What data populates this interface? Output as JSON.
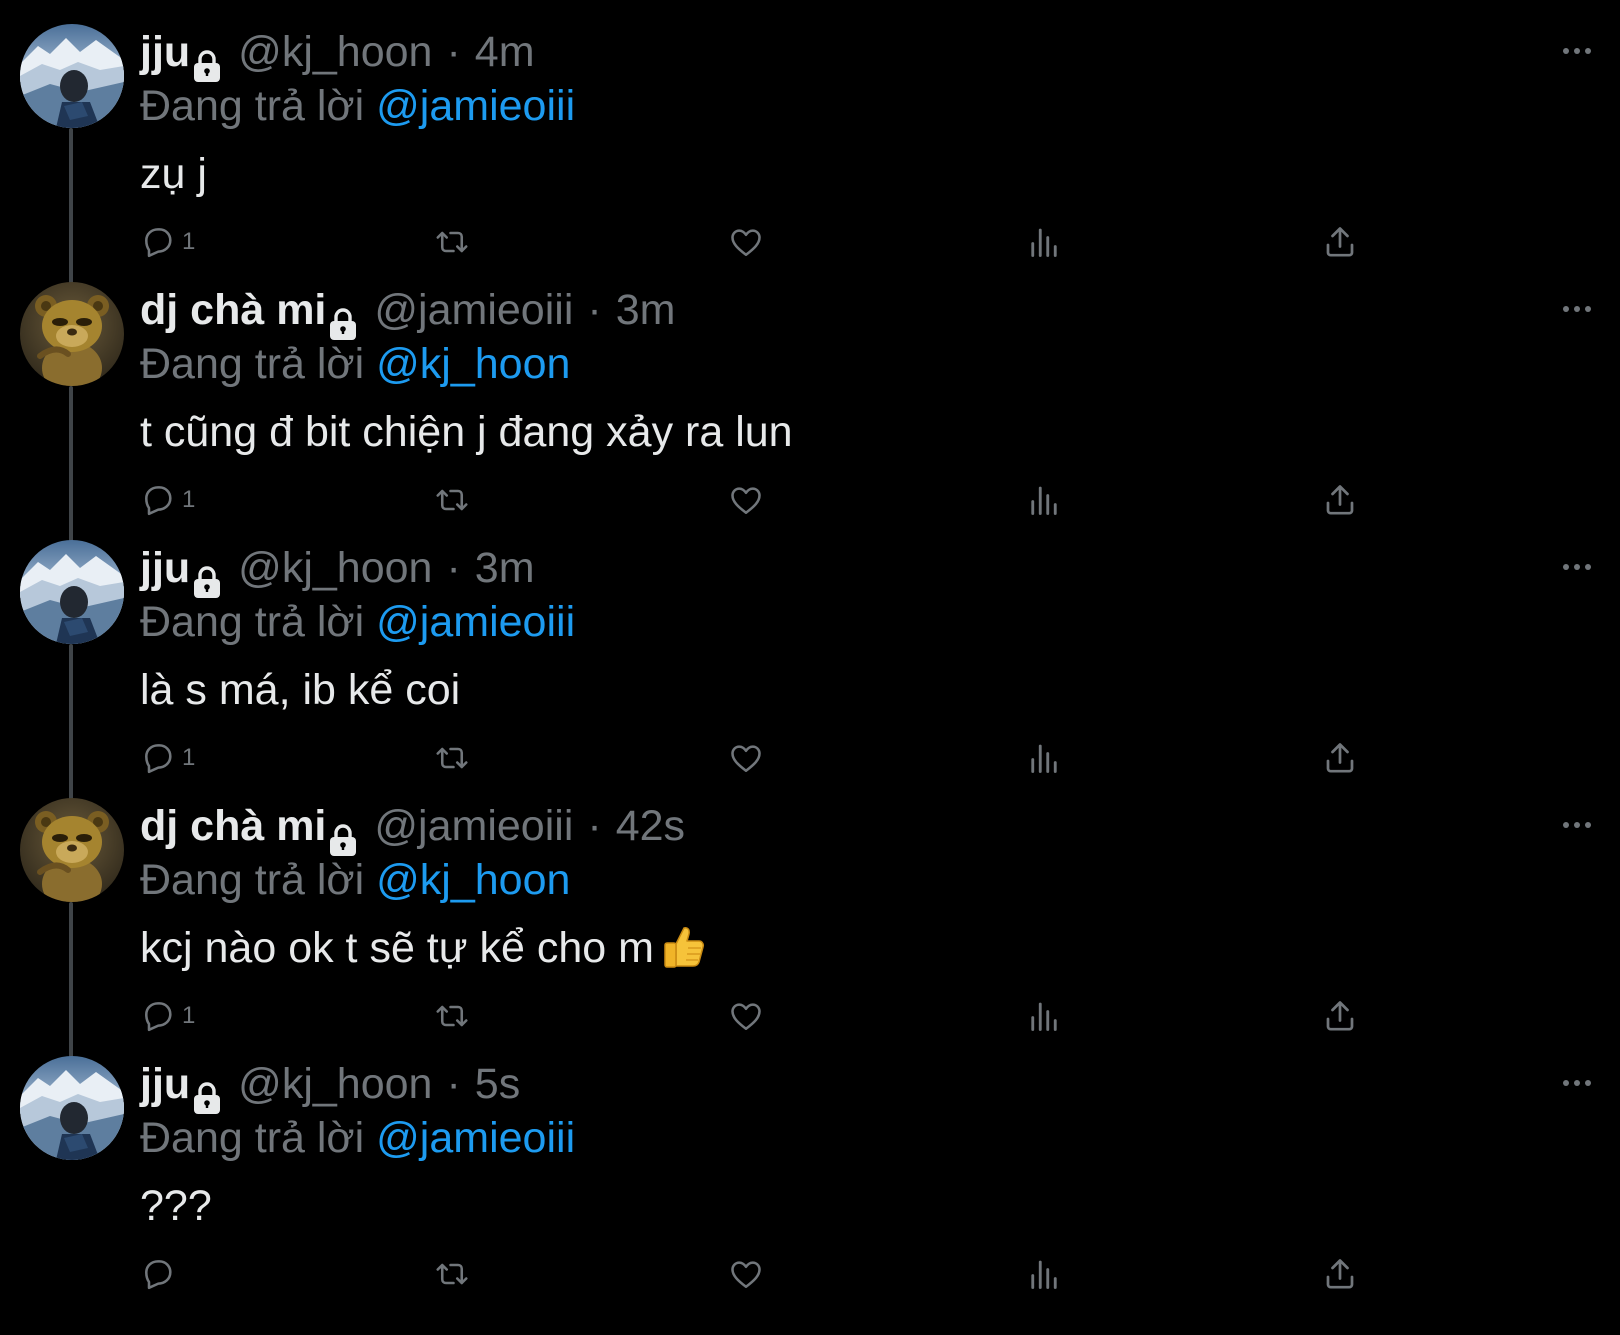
{
  "tweets": [
    {
      "avatar": "photo-mountain-avatar",
      "display_name": "jju",
      "handle": "@kj_hoon",
      "time": "4m",
      "reply_prefix": "Đang trả lời",
      "reply_to": "@jamieoiii",
      "text": "zụ j",
      "reply_count": "1",
      "has_emoji": false
    },
    {
      "avatar": "cartoon-bear-avatar",
      "display_name": "dj chà mi",
      "handle": "@jamieoiii",
      "time": "3m",
      "reply_prefix": "Đang trả lời",
      "reply_to": "@kj_hoon",
      "text": "t cũng đ bit chiện j đang xảy ra lun",
      "reply_count": "1",
      "has_emoji": false
    },
    {
      "avatar": "photo-mountain-avatar",
      "display_name": "jju",
      "handle": "@kj_hoon",
      "time": "3m",
      "reply_prefix": "Đang trả lời",
      "reply_to": "@jamieoiii",
      "text": "là s má, ib kể coi",
      "reply_count": "1",
      "has_emoji": false
    },
    {
      "avatar": "cartoon-bear-avatar",
      "display_name": "dj chà mi",
      "handle": "@jamieoiii",
      "time": "42s",
      "reply_prefix": "Đang trả lời",
      "reply_to": "@kj_hoon",
      "text": "kcj nào ok t sẽ tự kể cho m",
      "reply_count": "1",
      "has_emoji": true,
      "emoji": "thumbs-up"
    },
    {
      "avatar": "photo-mountain-avatar",
      "display_name": "jju",
      "handle": "@kj_hoon",
      "time": "5s",
      "reply_prefix": "Đang trả lời",
      "reply_to": "@jamieoiii",
      "text": "???",
      "reply_count": "",
      "has_emoji": false
    }
  ],
  "icons": {
    "lock": "lock-icon",
    "more": "more-icon",
    "reply": "reply-icon",
    "retweet": "retweet-icon",
    "like": "heart-icon",
    "views": "views-icon",
    "share": "share-icon"
  },
  "colors": {
    "background": "#000000",
    "primary_text": "#e7e9ea",
    "secondary_text": "#71767b",
    "link": "#1d9bf0",
    "thread_line": "#3f4448"
  }
}
